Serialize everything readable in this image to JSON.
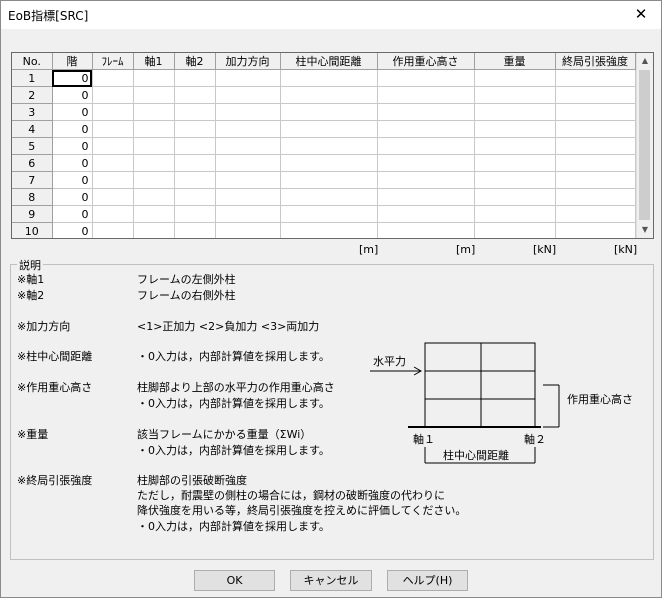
{
  "window": {
    "title": "EoB指標[SRC]",
    "close_glyph": "✕"
  },
  "grid": {
    "columns": [
      "No.",
      "階",
      "ﾌﾚｰﾑ",
      "軸1",
      "軸2",
      "加力方向",
      "柱中心間距離",
      "作用重心高さ",
      "重量",
      "終局引張強度"
    ],
    "rows": [
      {
        "no": "1",
        "floor": "0"
      },
      {
        "no": "2",
        "floor": "0"
      },
      {
        "no": "3",
        "floor": "0"
      },
      {
        "no": "4",
        "floor": "0"
      },
      {
        "no": "5",
        "floor": "0"
      },
      {
        "no": "6",
        "floor": "0"
      },
      {
        "no": "7",
        "floor": "0"
      },
      {
        "no": "8",
        "floor": "0"
      },
      {
        "no": "9",
        "floor": "0"
      },
      {
        "no": "10",
        "floor": "0"
      }
    ],
    "units": [
      "[m]",
      "[m]",
      "[kN]",
      "[kN]"
    ]
  },
  "explanation": {
    "label": "説明",
    "items": [
      {
        "key": "※軸1",
        "lines": [
          "フレームの左側外柱"
        ]
      },
      {
        "key": "※軸2",
        "lines": [
          "フレームの右側外柱"
        ]
      },
      {
        "key": "※加力方向",
        "lines": [
          "<1>正加力 <2>負加力 <3>両加力"
        ]
      },
      {
        "key": "※柱中心間距離",
        "lines": [
          "・0入力は，内部計算値を採用します。"
        ]
      },
      {
        "key": "※作用重心高さ",
        "lines": [
          "柱脚部より上部の水平力の作用重心高さ",
          "・0入力は，内部計算値を採用します。"
        ]
      },
      {
        "key": "※重量",
        "lines": [
          "該当フレームにかかる重量（ΣWi）",
          "・0入力は，内部計算値を採用します。"
        ]
      },
      {
        "key": "※終局引張強度",
        "lines": [
          "柱脚部の引張破断強度",
          "ただし，耐震壁の側柱の場合には，鋼材の破断強度の代わりに",
          "降伏強度を用いる等，終局引張強度を控えめに評価してください。",
          "・0入力は，内部計算値を採用します。"
        ]
      }
    ]
  },
  "diagram": {
    "horizontal_force": "水平力",
    "height_label": "作用重心高さ",
    "axis1": "軸１",
    "axis2": "軸２",
    "distance_label": "柱中心間距離"
  },
  "buttons": {
    "ok": "OK",
    "cancel": "キャンセル",
    "help": "ヘルプ(H)"
  }
}
